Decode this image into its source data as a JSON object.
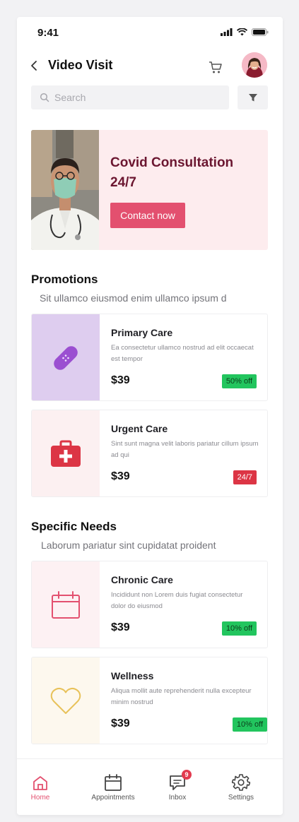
{
  "status_bar": {
    "time": "9:41"
  },
  "header": {
    "title": "Video Visit"
  },
  "search": {
    "placeholder": "Search"
  },
  "hero": {
    "title": "Covid Consultation 24/7",
    "button_label": "Contact now"
  },
  "promotions": {
    "title": "Promotions",
    "subtitle": "Sit ullamco eiusmod enim ullamco ipsum d",
    "cards": [
      {
        "title": "Primary Care",
        "description": "Ea consectetur ullamco nostrud ad elit occaecat est tempor",
        "price": "$39",
        "badge": "50% off",
        "badge_color": "#22c55e",
        "icon": "bandage-icon",
        "media_bg": "#decdef"
      },
      {
        "title": "Urgent Care",
        "description": "Sint sunt magna velit laboris pariatur cillum ipsum ad qui",
        "price": "$39",
        "badge": "24/7",
        "badge_color": "#dc3545",
        "icon": "first-aid-kit-icon",
        "media_bg": "#fcf0f1"
      }
    ]
  },
  "specific_needs": {
    "title": "Specific Needs",
    "subtitle": "Laborum pariatur sint cupidatat proident",
    "cards": [
      {
        "title": "Chronic Care",
        "description": "Incididunt non Lorem duis fugiat consectetur dolor do eiusmod",
        "price": "$39",
        "badge": "10% off",
        "badge_color": "#22c55e",
        "icon": "calendar-icon",
        "media_bg": "#fdf1f3"
      },
      {
        "title": "Wellness",
        "description": "Aliqua mollit aute reprehenderit nulla excepteur minim nostrud",
        "price": "$39",
        "badge": "10% off",
        "badge_color": "#22c55e",
        "icon": "heart-icon",
        "media_bg": "#fdf8ee"
      }
    ]
  },
  "bottom_nav": {
    "items": [
      {
        "label": "Home",
        "icon": "home-icon",
        "active": true
      },
      {
        "label": "Appointments",
        "icon": "calendar-icon",
        "active": false
      },
      {
        "label": "Inbox",
        "icon": "chat-icon",
        "active": false,
        "badge": "9"
      },
      {
        "label": "Settings",
        "icon": "gear-icon",
        "active": false
      }
    ]
  },
  "colors": {
    "accent": "#e3506f",
    "hero_bg": "#fdecee",
    "hero_title": "#6b1630",
    "success": "#22c55e",
    "danger": "#dc3545"
  }
}
